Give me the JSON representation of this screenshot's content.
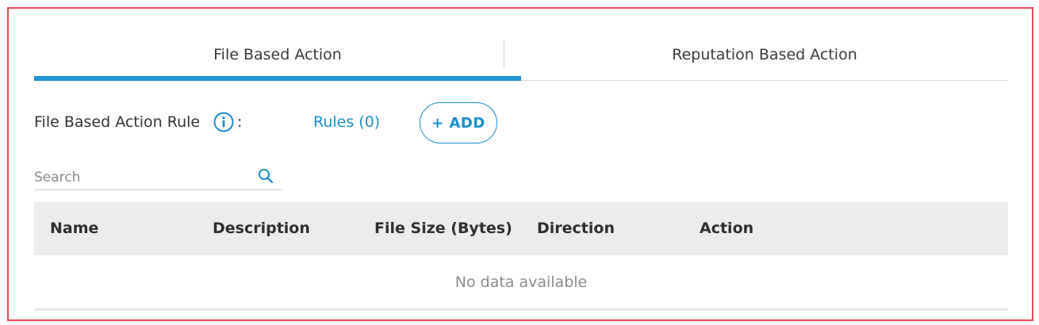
{
  "tabs": [
    {
      "label": "File Based Action",
      "active": true
    },
    {
      "label": "Reputation Based Action",
      "active": false
    }
  ],
  "rule_section": {
    "label": "File Based Action Rule",
    "colon": ":",
    "info_icon": "info-icon",
    "rules_link": "Rules (0)",
    "add_button": "+ ADD"
  },
  "search": {
    "placeholder": "Search",
    "value": "",
    "icon": "search-icon"
  },
  "table": {
    "columns": [
      "Name",
      "Description",
      "File Size (Bytes)",
      "Direction",
      "Action"
    ],
    "rows": [],
    "empty_message": "No data available"
  },
  "colors": {
    "accent": "#1a8fcd",
    "tab_indicator": "#1f94d2",
    "outer_border": "#e8474f",
    "header_bg": "#ececec"
  }
}
